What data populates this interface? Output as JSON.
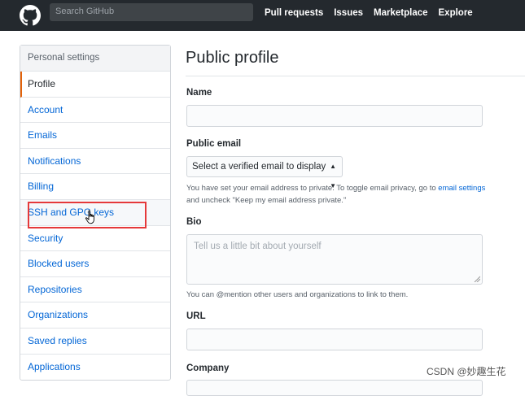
{
  "header": {
    "search_placeholder": "Search GitHub",
    "nav": [
      "Pull requests",
      "Issues",
      "Marketplace",
      "Explore"
    ]
  },
  "sidebar": {
    "heading": "Personal settings",
    "items": [
      {
        "label": "Profile"
      },
      {
        "label": "Account"
      },
      {
        "label": "Emails"
      },
      {
        "label": "Notifications"
      },
      {
        "label": "Billing"
      },
      {
        "label": "SSH and GPG keys"
      },
      {
        "label": "Security"
      },
      {
        "label": "Blocked users"
      },
      {
        "label": "Repositories"
      },
      {
        "label": "Organizations"
      },
      {
        "label": "Saved replies"
      },
      {
        "label": "Applications"
      }
    ]
  },
  "main": {
    "title": "Public profile",
    "name_label": "Name",
    "email_label": "Public email",
    "email_select": "Select a verified email to display",
    "email_note_1": "You have set your email address to private. To toggle email privacy, go to ",
    "email_note_link": "email settings",
    "email_note_2": "and uncheck \"Keep my email address private.\"",
    "bio_label": "Bio",
    "bio_placeholder": "Tell us a little bit about yourself",
    "bio_note": "You can @mention other users and organizations to link to them.",
    "url_label": "URL",
    "company_label": "Company"
  },
  "watermark": "CSDN @妙趣生花",
  "colors": {
    "header_bg": "#24292e",
    "link": "#0366d6",
    "active_marker": "#e36209",
    "annotation": "#e5393a"
  }
}
